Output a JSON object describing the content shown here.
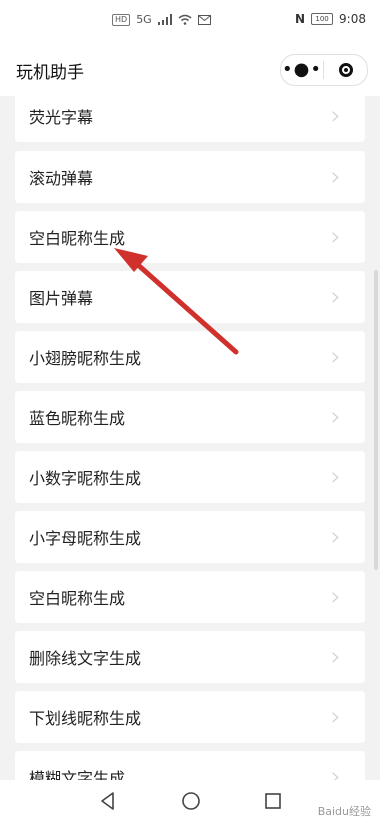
{
  "status_bar": {
    "hd_badge": "HD",
    "network": "5G",
    "nfc": "N",
    "battery": "100",
    "time": "9:08"
  },
  "nav": {
    "title": "玩机助手",
    "more_icon": "more-dots-icon",
    "close_icon": "miniprogram-close-icon"
  },
  "list": {
    "items": [
      {
        "label": "荧光字幕"
      },
      {
        "label": "滚动弹幕"
      },
      {
        "label": "空白昵称生成"
      },
      {
        "label": "图片弹幕"
      },
      {
        "label": "小翅膀昵称生成"
      },
      {
        "label": "蓝色昵称生成"
      },
      {
        "label": "小数字昵称生成"
      },
      {
        "label": "小字母昵称生成"
      },
      {
        "label": "空白昵称生成"
      },
      {
        "label": "删除线文字生成"
      },
      {
        "label": "下划线昵称生成"
      },
      {
        "label": "模糊文字生成"
      }
    ]
  },
  "annotation": {
    "arrow_color": "#d0312d"
  },
  "watermark": "Baidu经验"
}
